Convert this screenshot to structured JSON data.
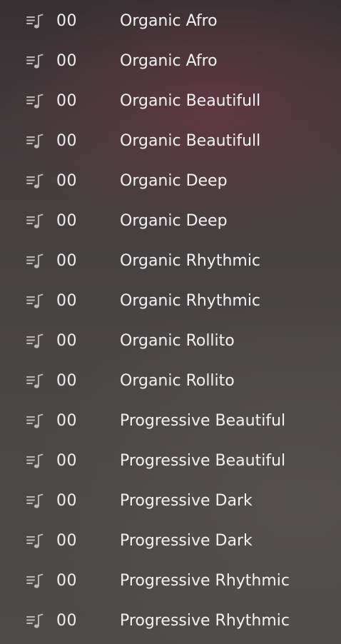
{
  "playlist": {
    "items": [
      {
        "number": "00",
        "title": "Organic Afro",
        "icon": "music-note-list-icon"
      },
      {
        "number": "00",
        "title": "Organic Afro",
        "icon": "music-note-list-icon"
      },
      {
        "number": "00",
        "title": "Organic Beautifull",
        "icon": "music-note-list-icon"
      },
      {
        "number": "00",
        "title": "Organic Beautifull",
        "icon": "music-note-list-icon"
      },
      {
        "number": "00",
        "title": "Organic Deep",
        "icon": "music-note-list-icon"
      },
      {
        "number": "00",
        "title": "Organic Deep",
        "icon": "music-note-list-icon"
      },
      {
        "number": "00",
        "title": "Organic Rhythmic",
        "icon": "music-note-list-icon"
      },
      {
        "number": "00",
        "title": "Organic Rhythmic",
        "icon": "music-note-list-icon"
      },
      {
        "number": "00",
        "title": "Organic Rollito",
        "icon": "music-note-list-icon"
      },
      {
        "number": "00",
        "title": "Organic Rollito",
        "icon": "music-note-list-icon"
      },
      {
        "number": "00",
        "title": "Progressive Beautiful",
        "icon": "music-note-list-icon"
      },
      {
        "number": "00",
        "title": "Progressive Beautiful",
        "icon": "music-note-list-icon"
      },
      {
        "number": "00",
        "title": "Progressive Dark",
        "icon": "music-note-list-icon"
      },
      {
        "number": "00",
        "title": "Progressive Dark",
        "icon": "music-note-list-icon"
      },
      {
        "number": "00",
        "title": "Progressive Rhythmic",
        "icon": "music-note-list-icon"
      },
      {
        "number": "00",
        "title": "Progressive Rhythmic",
        "icon": "music-note-list-icon"
      }
    ]
  }
}
